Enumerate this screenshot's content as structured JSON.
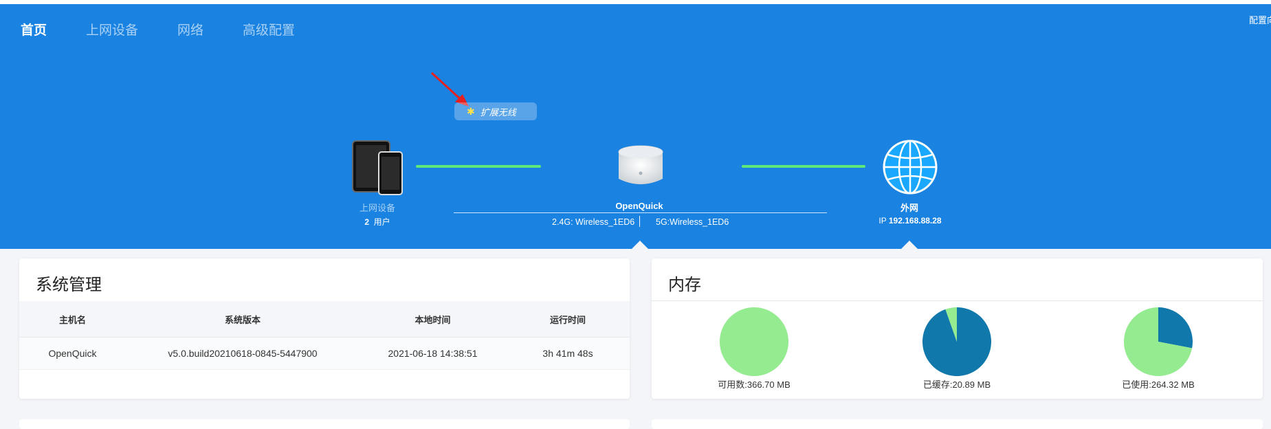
{
  "nav": {
    "items": [
      "首页",
      "上网设备",
      "网络",
      "高级配置"
    ],
    "active_index": 0,
    "top_right": "配置向导"
  },
  "topology": {
    "expand_wireless": "扩展无线",
    "devices": {
      "label": "上网设备",
      "count": "2",
      "unit": "用户"
    },
    "router": {
      "name": "OpenQuick",
      "ssid_24": "2.4G: Wireless_1ED6",
      "ssid_5": "5G:Wireless_1ED6"
    },
    "wan": {
      "name": "外网",
      "ip_prefix": "IP",
      "ip": "192.168.88.28"
    },
    "line_color": "#5ee87c",
    "hero_color": "#1a82e0"
  },
  "system": {
    "title": "系统管理",
    "columns": [
      "主机名",
      "系统版本",
      "本地时间",
      "运行时间"
    ],
    "row": [
      "OpenQuick",
      "v5.0.build20210618-0845-5447900",
      "2021-06-18 14:38:51",
      "3h 41m 48s"
    ]
  },
  "memory": {
    "title": "内存",
    "pies": [
      {
        "label": "可用数:366.70 MB",
        "fraction": 1.0
      },
      {
        "label": "已缓存:20.89 MB",
        "fraction": 0.054
      },
      {
        "label": "已使用:264.32 MB",
        "fraction": 0.72
      }
    ],
    "colors": {
      "primary": "#95eb8f",
      "secondary": "#1178ab"
    }
  }
}
